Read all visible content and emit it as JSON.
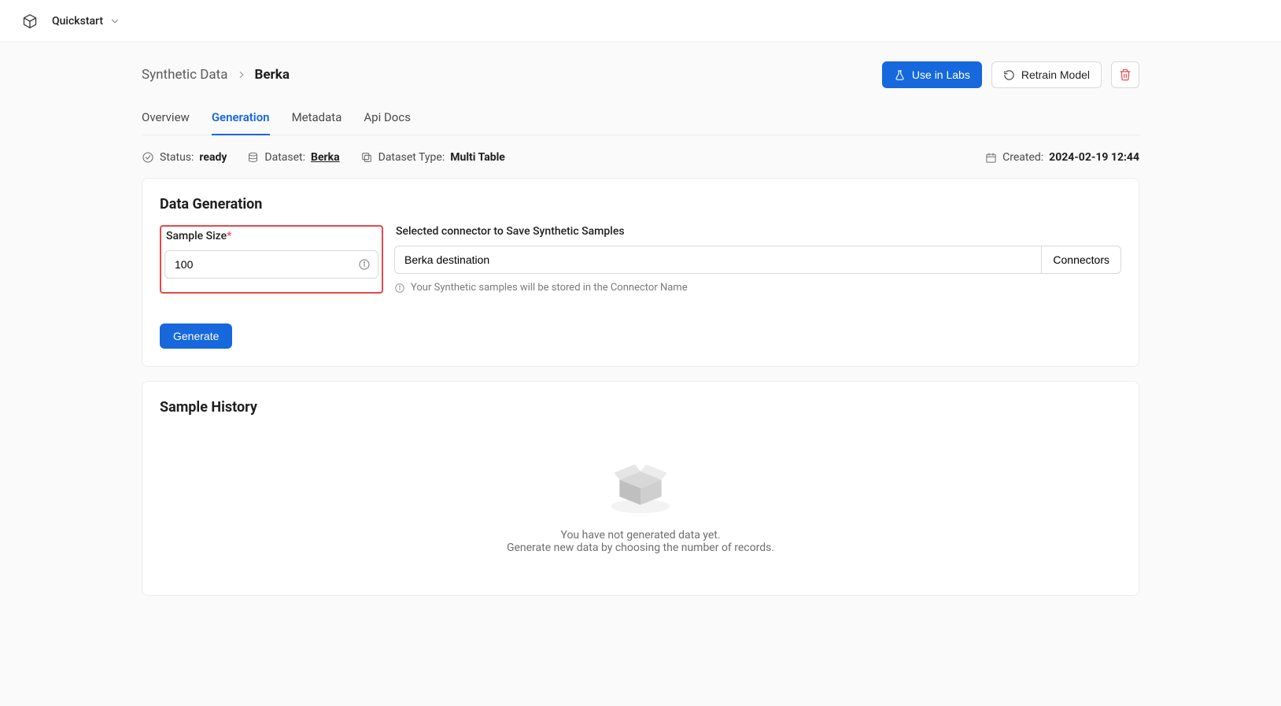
{
  "topbar": {
    "quickstart_label": "Quickstart"
  },
  "breadcrumb": {
    "root": "Synthetic Data",
    "current": "Berka"
  },
  "actions": {
    "use_in_labs": "Use in Labs",
    "retrain_model": "Retrain Model"
  },
  "tabs": [
    {
      "label": "Overview",
      "active": false
    },
    {
      "label": "Generation",
      "active": true
    },
    {
      "label": "Metadata",
      "active": false
    },
    {
      "label": "Api Docs",
      "active": false
    }
  ],
  "status": {
    "status_label": "Status:",
    "status_value": "ready",
    "dataset_label": "Dataset:",
    "dataset_value": "Berka",
    "dataset_type_label": "Dataset Type:",
    "dataset_type_value": "Multi Table",
    "created_label": "Created:",
    "created_value": "2024-02-19 12:44"
  },
  "generation": {
    "title": "Data Generation",
    "sample_size_label": "Sample Size",
    "sample_size_value": "100",
    "connector_label": "Selected connector to Save Synthetic Samples",
    "connector_value": "Berka destination",
    "connectors_button": "Connectors",
    "helper_text": "Your Synthetic samples will be stored in the Connector Name",
    "generate_button": "Generate"
  },
  "history": {
    "title": "Sample History",
    "empty_line1": "You have not generated data yet.",
    "empty_line2": "Generate new data by choosing the number of records."
  }
}
